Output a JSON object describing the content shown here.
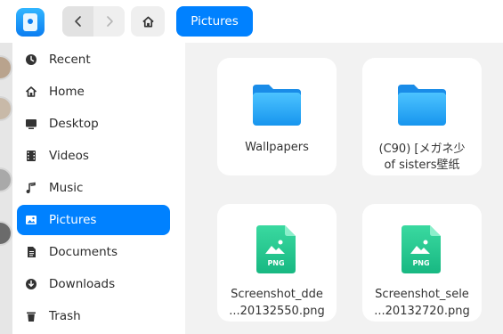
{
  "header": {
    "app_icon": "file-manager-icon",
    "back_icon": "chevron-left-icon",
    "forward_icon": "chevron-right-icon",
    "home_icon": "home-icon",
    "breadcrumb": "Pictures",
    "accent_color": "#0081ff"
  },
  "sidebar": {
    "items": [
      {
        "label": "Recent",
        "icon": "clock-icon"
      },
      {
        "label": "Home",
        "icon": "home-icon"
      },
      {
        "label": "Desktop",
        "icon": "desktop-icon"
      },
      {
        "label": "Videos",
        "icon": "film-icon"
      },
      {
        "label": "Music",
        "icon": "music-note-icon"
      },
      {
        "label": "Pictures",
        "icon": "image-icon",
        "active": true
      },
      {
        "label": "Documents",
        "icon": "document-icon"
      },
      {
        "label": "Downloads",
        "icon": "download-icon"
      },
      {
        "label": "Trash",
        "icon": "trash-icon"
      }
    ]
  },
  "files": [
    {
      "line1": "Wallpapers",
      "line2": "",
      "type": "folder"
    },
    {
      "line1": "(C90) [メガネ少",
      "line2": "of sisters壁纸",
      "type": "folder"
    },
    {
      "line1": "Screenshot_dde",
      "line2": "...20132550.png",
      "type": "png",
      "badge": "PNG"
    },
    {
      "line1": "Screenshot_sele",
      "line2": "...20132720.png",
      "type": "png",
      "badge": "PNG"
    }
  ]
}
